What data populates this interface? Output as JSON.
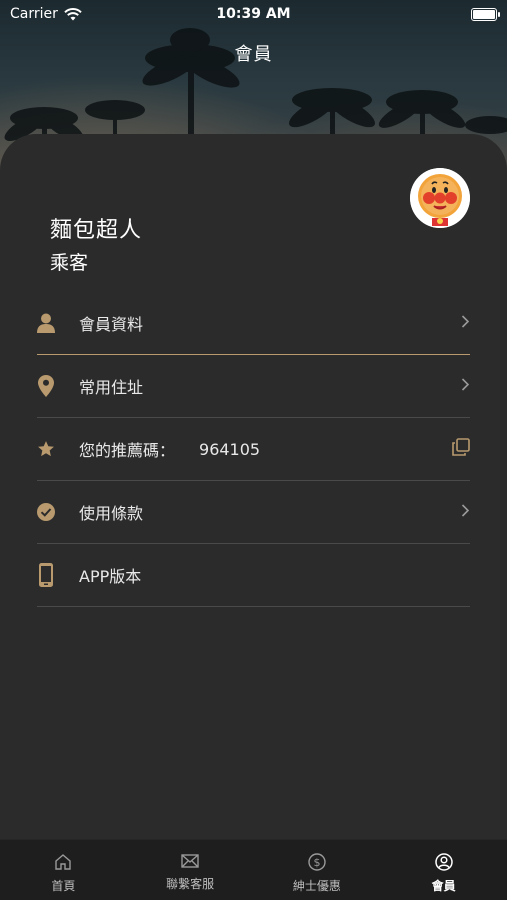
{
  "status_bar": {
    "carrier": "Carrier",
    "time": "10:39 AM",
    "battery_level": 1.0
  },
  "header": {
    "title": "會員"
  },
  "user": {
    "name": "麵包超人",
    "role": "乘客",
    "avatar_icon": "anpanman-avatar"
  },
  "menu": [
    {
      "label": "會員資料",
      "icon": "person-icon",
      "trailing": "chevron"
    },
    {
      "label": "常用住址",
      "icon": "location-pin-icon",
      "trailing": "chevron"
    },
    {
      "label": "您的推薦碼：",
      "value": "964105",
      "icon": "star-icon",
      "trailing": "copy"
    },
    {
      "label": "使用條款",
      "icon": "check-circle-icon",
      "trailing": "chevron"
    },
    {
      "label": "APP版本",
      "icon": "phone-icon",
      "trailing": "none"
    }
  ],
  "tabs": [
    {
      "label": "首頁",
      "icon": "home-icon"
    },
    {
      "label": "聯繫客服",
      "icon": "mail-icon"
    },
    {
      "label": "紳士優惠",
      "icon": "dollar-icon"
    },
    {
      "label": "會員",
      "icon": "user-circle-icon",
      "active": true
    }
  ],
  "colors": {
    "accent": "#b89a6e",
    "card": "#2b2b2b",
    "tabbar": "#1e1e1e"
  }
}
